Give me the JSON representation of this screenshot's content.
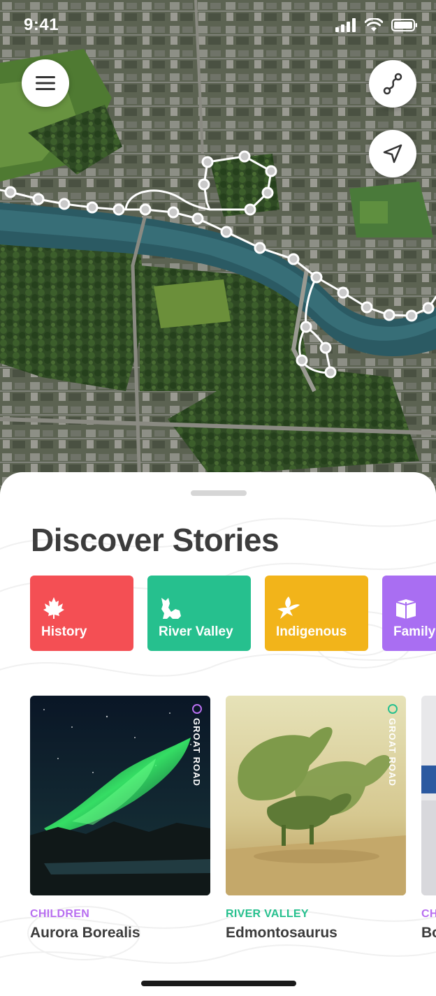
{
  "status_bar": {
    "time": "9:41"
  },
  "map": {
    "route_color": "#ffffff",
    "point_fill": "#c9c9c9"
  },
  "sheet": {
    "title": "Discover Stories",
    "categories": [
      {
        "label": "History",
        "color": "#f44f54",
        "icon": "maple-leaf-icon"
      },
      {
        "label": "River Valley",
        "color": "#26c08e",
        "icon": "animal-icon"
      },
      {
        "label": "Indigenous",
        "color": "#f2b41a",
        "icon": "bird-icon"
      },
      {
        "label": "Family",
        "color": "#a96ef2",
        "icon": "gift-box-icon"
      }
    ],
    "stories": [
      {
        "category": "CHILDREN",
        "category_color": "#b86ff0",
        "title": "Aurora Borealis",
        "location": "GROAT ROAD"
      },
      {
        "category": "RIVER VALLEY",
        "category_color": "#26c08e",
        "title": "Edmontosaurus",
        "location": "GROAT ROAD"
      },
      {
        "category": "CHI",
        "category_color": "#b86ff0",
        "title": "Bo",
        "location": ""
      }
    ]
  }
}
